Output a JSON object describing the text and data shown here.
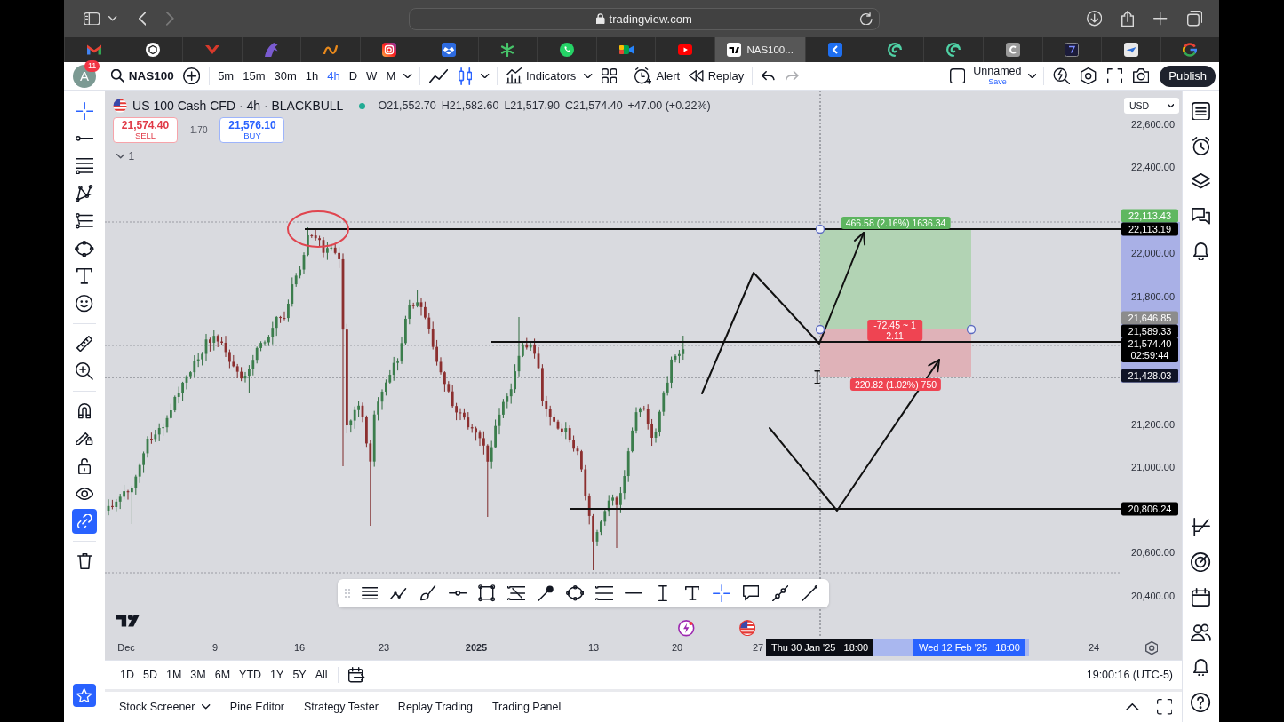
{
  "browser": {
    "back": {
      "disabled": false
    },
    "forward": {
      "disabled": true
    },
    "address": "tradingview.com",
    "tabs": [
      {
        "selected": false
      },
      {
        "selected": false
      },
      {
        "selected": false
      },
      {
        "selected": false
      },
      {
        "selected": false
      },
      {
        "selected": false
      },
      {
        "selected": false
      },
      {
        "selected": false
      },
      {
        "selected": false
      },
      {
        "selected": false
      },
      {
        "selected": false
      },
      {
        "title": "NAS100...",
        "selected": true
      },
      {
        "selected": false
      },
      {
        "selected": false
      },
      {
        "selected": false
      },
      {
        "selected": false
      },
      {
        "selected": false
      },
      {
        "selected": false
      },
      {
        "selected": false
      }
    ]
  },
  "toolbar": {
    "user": {
      "initial": "A",
      "badge": "11"
    },
    "symbol": "NAS100",
    "intervals": [
      {
        "label": "5m",
        "selected": false
      },
      {
        "label": "15m",
        "selected": false
      },
      {
        "label": "30m",
        "selected": false
      },
      {
        "label": "1h",
        "selected": false
      },
      {
        "label": "4h",
        "selected": true
      },
      {
        "label": "D",
        "selected": false
      },
      {
        "label": "W",
        "selected": false
      },
      {
        "label": "M",
        "selected": false
      }
    ],
    "chart_types": [
      {
        "selected": false
      },
      {
        "selected": true
      }
    ],
    "indicators": "Indicators",
    "alert": "Alert",
    "replay": "Replay",
    "undo": {
      "disabled": false
    },
    "redo": {
      "disabled": true
    },
    "layout": {
      "name": "Unnamed",
      "action": "Save"
    },
    "publish": "Publish"
  },
  "left_toolbar": {
    "tools": [
      {
        "selected": true
      },
      {
        "selected": false
      },
      {
        "selected": false
      },
      {
        "selected": false
      },
      {
        "selected": false
      },
      {
        "selected": false
      },
      {
        "selected": false
      },
      {
        "selected": false
      },
      {
        "selected": false
      },
      {
        "selected": false
      }
    ],
    "toggles": [
      {
        "on": false
      },
      {
        "on": false
      },
      {
        "on": false
      },
      {
        "on": false
      },
      {
        "on": true
      }
    ],
    "watchlist": {
      "selected": true
    }
  },
  "chart": {
    "legend": {
      "title": "US 100 Cash CFD · 4h · BLACKBULL",
      "live": true,
      "ohlc": [
        "O21,552.70",
        "H21,582.60",
        "L21,517.90",
        "C21,574.40",
        "+47.00 (+0.22%)"
      ]
    },
    "sell": {
      "price": "21,574.40",
      "label": "SELL"
    },
    "spread": "1.70",
    "buy": {
      "price": "21,576.10",
      "label": "BUY"
    },
    "indicators": {
      "count": "1",
      "expanded": false
    },
    "currency": "USD",
    "price_ticks": [
      "22,600.00",
      "22,400.00",
      "22,000.00",
      "21,800.00",
      "21,200.00",
      "21,000.00",
      "20,600.00",
      "20,400.00"
    ],
    "price_labels": [
      {
        "text": "22,113.43",
        "color": "#5fb760"
      },
      {
        "text": "22,113.19",
        "color": "#000000"
      },
      {
        "text": "21,646.85",
        "color": "#8c8c8c"
      },
      {
        "text": "21,589.33",
        "color": "#000000"
      },
      {
        "text": "21,574.40",
        "subtext": "02:59:44",
        "color": "#000000"
      },
      {
        "text": "21,428.03",
        "color": "#101426"
      },
      {
        "text": "20,806.24",
        "color": "#000000"
      }
    ],
    "time_ticks": [
      {
        "text": "Dec",
        "kind": "month"
      },
      {
        "text": "9",
        "kind": "day"
      },
      {
        "text": "16",
        "kind": "day"
      },
      {
        "text": "23",
        "kind": "day"
      },
      {
        "text": "2025",
        "kind": "year"
      },
      {
        "text": "13",
        "kind": "day"
      },
      {
        "text": "20",
        "kind": "day"
      },
      {
        "text": "27",
        "kind": "day"
      },
      {
        "text": "24",
        "kind": "day"
      }
    ],
    "time_range": {
      "start": "Thu 30 Jan '25   18:00",
      "end": "Wed 12 Feb '25   18:00"
    },
    "position": {
      "target": "466.58 (2.16%) 1636.34",
      "center": [
        "-72.45 ~ 1",
        "2.11"
      ],
      "stop": "220.82 (1.02%) 750"
    },
    "drawing_toolbar": [
      {
        "selected": false
      },
      {
        "selected": false
      },
      {
        "selected": false
      },
      {
        "selected": false
      },
      {
        "selected": false
      },
      {
        "selected": false
      },
      {
        "selected": false
      },
      {
        "selected": false
      },
      {
        "selected": false
      },
      {
        "selected": false
      },
      {
        "selected": false
      },
      {
        "selected": false
      },
      {
        "selected": true
      },
      {
        "selected": false
      },
      {
        "selected": false
      },
      {
        "selected": false
      }
    ]
  },
  "range_bar": {
    "ranges": [
      "1D",
      "5D",
      "1M",
      "3M",
      "6M",
      "YTD",
      "1Y",
      "5Y",
      "All"
    ],
    "clock": "19:00:16 (UTC-5)"
  },
  "bottom_panel": {
    "tabs": [
      {
        "label": "Stock Screener",
        "dropdown": true
      },
      {
        "label": "Pine Editor",
        "dropdown": false
      },
      {
        "label": "Strategy Tester",
        "dropdown": false
      },
      {
        "label": "Replay Trading",
        "dropdown": false
      },
      {
        "label": "Trading Panel",
        "dropdown": false
      }
    ]
  }
}
